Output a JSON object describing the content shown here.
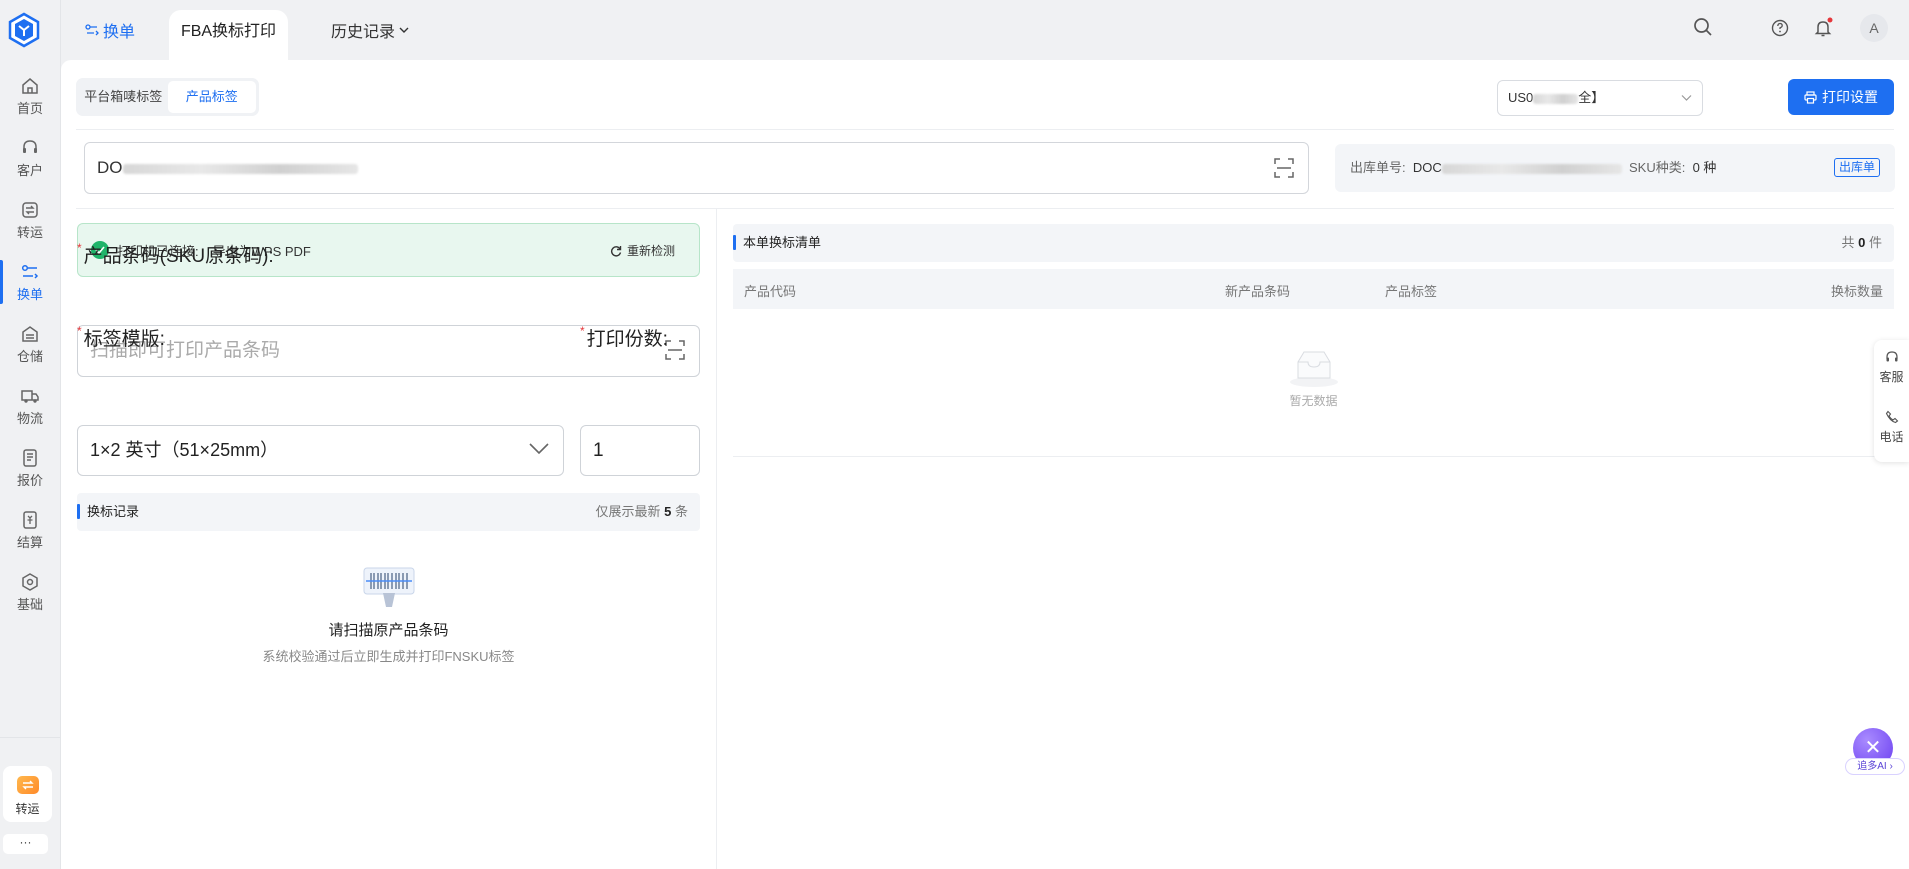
{
  "nav": {
    "items": [
      {
        "label": "首页",
        "icon": "home-icon"
      },
      {
        "label": "客户",
        "icon": "headset-icon"
      },
      {
        "label": "转运",
        "icon": "transfer-icon"
      },
      {
        "label": "换单",
        "icon": "swap-icon"
      },
      {
        "label": "仓储",
        "icon": "warehouse-icon"
      },
      {
        "label": "物流",
        "icon": "truck-icon"
      },
      {
        "label": "报价",
        "icon": "quote-icon"
      },
      {
        "label": "结算",
        "icon": "settlement-icon"
      },
      {
        "label": "基础",
        "icon": "settings-icon"
      }
    ],
    "active": "换单",
    "quick_label": "转运",
    "more_label": "···"
  },
  "topbar": {
    "tab_swap": "换单",
    "tab_fba": "FBA换标打印",
    "tab_history": "历史记录",
    "avatar": "A"
  },
  "toolbar": {
    "seg_platform": "平台箱唛标签",
    "seg_product": "产品标签",
    "warehouse_prefix": "US0",
    "warehouse_suffix": "全】",
    "print_settings": "打印设置"
  },
  "scan": {
    "value_prefix": "DO"
  },
  "order_info": {
    "order_no_label": "出库单号:",
    "order_no_prefix": "DOC",
    "sku_kind_label": "SKU种类:",
    "sku_kind_value": "0 种",
    "tag": "出库单"
  },
  "printer": {
    "status_label": "打印机已连接:",
    "status_value": "导出为WPS PDF",
    "recheck": "重新检测"
  },
  "form": {
    "code_label": "产品条码(SKU原条码):",
    "code_placeholder": "扫描即可打印产品条码",
    "template_label": "标签模版:",
    "template_value": "1×2 英寸（51×25mm）",
    "copies_label": "打印份数:",
    "copies_value": "1"
  },
  "records": {
    "title": "换标记录",
    "hint_prefix": "仅展示最新",
    "hint_count": "5",
    "hint_suffix": "条",
    "empty_title": "请扫描原产品条码",
    "empty_desc": "系统校验通过后立即生成并打印FNSKU标签"
  },
  "list": {
    "title": "本单换标清单",
    "total_prefix": "共",
    "total_count": "0",
    "total_suffix": "件",
    "columns": [
      "产品代码",
      "新产品条码",
      "产品标签",
      "换标数量"
    ],
    "empty": "暂无数据"
  },
  "float": {
    "service": "客服",
    "phone": "电话",
    "ai_label": "追多AI ›"
  },
  "colors": {
    "primary": "#1e6ff1",
    "success": "#20b46a",
    "required": "#e5373b"
  }
}
